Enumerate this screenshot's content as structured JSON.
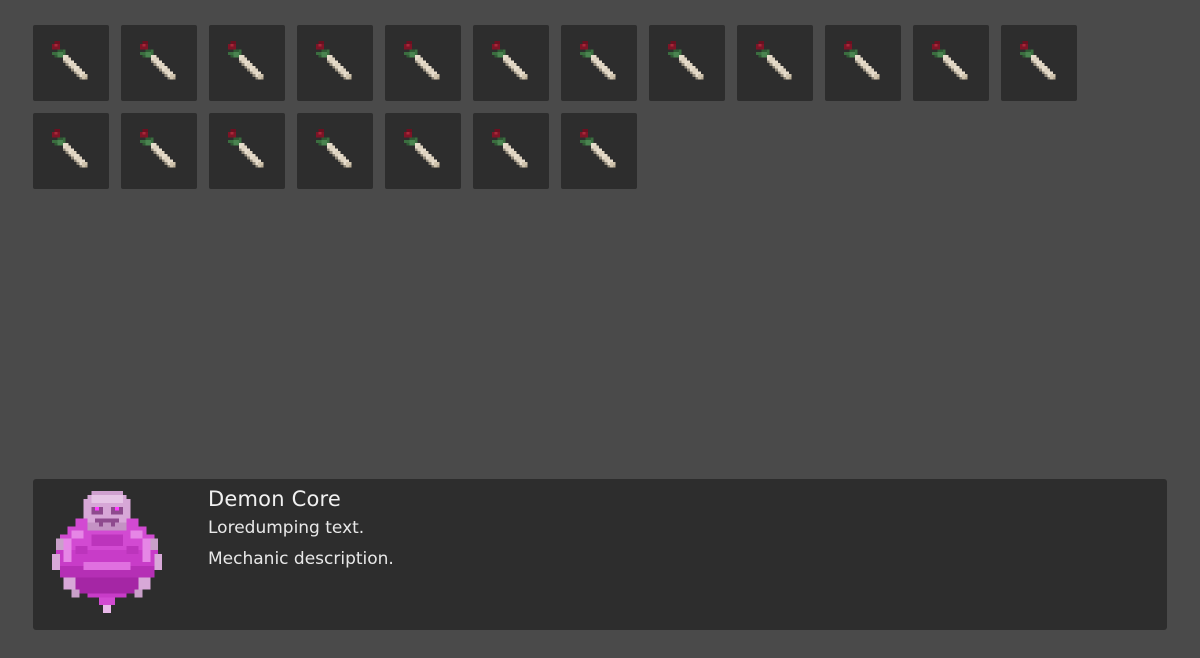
{
  "inventory": {
    "slot_count": 19,
    "slot_icon": "pixel-dagger-icon",
    "selected_index": null
  },
  "colors": {
    "background": "#4a4a4a",
    "slot": "#2d2d2d",
    "panel": "#2d2d2d",
    "accent_magenta": "#c03cc0"
  },
  "info": {
    "name": "Demon Core",
    "lore": "Loredumping text.",
    "mechanic": "Mechanic description.",
    "portrait_icon": "demon-core-icon"
  }
}
